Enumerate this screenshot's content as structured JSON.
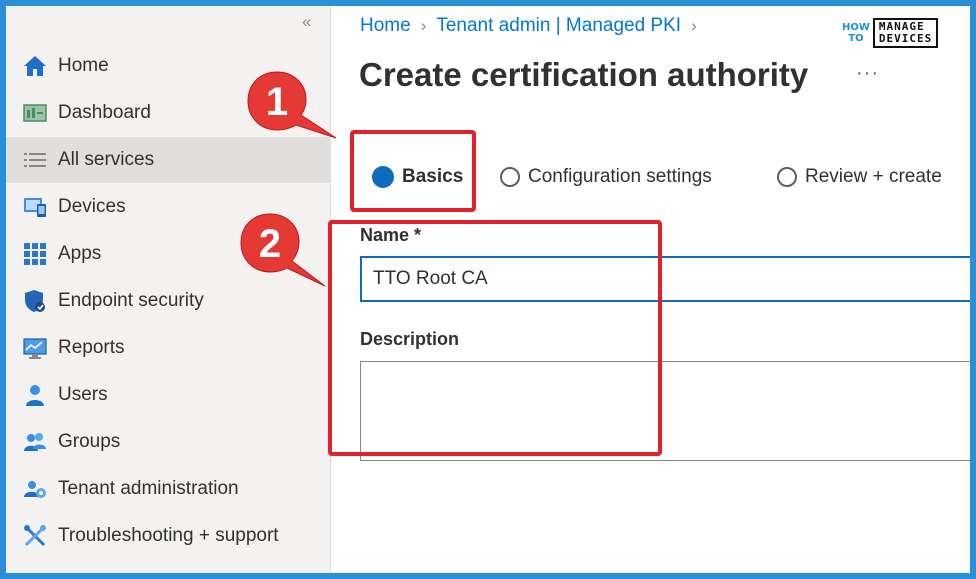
{
  "sidebar": {
    "collapse_glyph": "«",
    "items": [
      {
        "label": "Home",
        "icon": "home-icon"
      },
      {
        "label": "Dashboard",
        "icon": "dashboard-icon"
      },
      {
        "label": "All services",
        "icon": "all-services-icon",
        "selected": true
      },
      {
        "label": "Devices",
        "icon": "devices-icon"
      },
      {
        "label": "Apps",
        "icon": "apps-icon"
      },
      {
        "label": "Endpoint security",
        "icon": "endpoint-security-icon"
      },
      {
        "label": "Reports",
        "icon": "reports-icon"
      },
      {
        "label": "Users",
        "icon": "users-icon"
      },
      {
        "label": "Groups",
        "icon": "groups-icon"
      },
      {
        "label": "Tenant administration",
        "icon": "tenant-administration-icon"
      },
      {
        "label": "Troubleshooting + support",
        "icon": "troubleshooting-icon"
      }
    ]
  },
  "breadcrumb": {
    "items": [
      "Home",
      "Tenant admin | Managed PKI"
    ]
  },
  "page": {
    "title": "Create certification authority",
    "more": "···"
  },
  "brand": {
    "how": "HOW",
    "to": "TO",
    "manage": "MANAGE",
    "devices": "DEVICES"
  },
  "tabs": [
    {
      "label": "Basics",
      "active": true
    },
    {
      "label": "Configuration settings",
      "active": false
    },
    {
      "label": "Review + create",
      "active": false
    }
  ],
  "form": {
    "name_label": "Name *",
    "name_value": "TTO Root CA",
    "description_label": "Description",
    "description_value": ""
  },
  "annotations": {
    "marker_1": "1",
    "marker_2": "2"
  },
  "colors": {
    "accent": "#0078d4",
    "highlight": "#e0202a",
    "frame": "#2a8fd6"
  }
}
